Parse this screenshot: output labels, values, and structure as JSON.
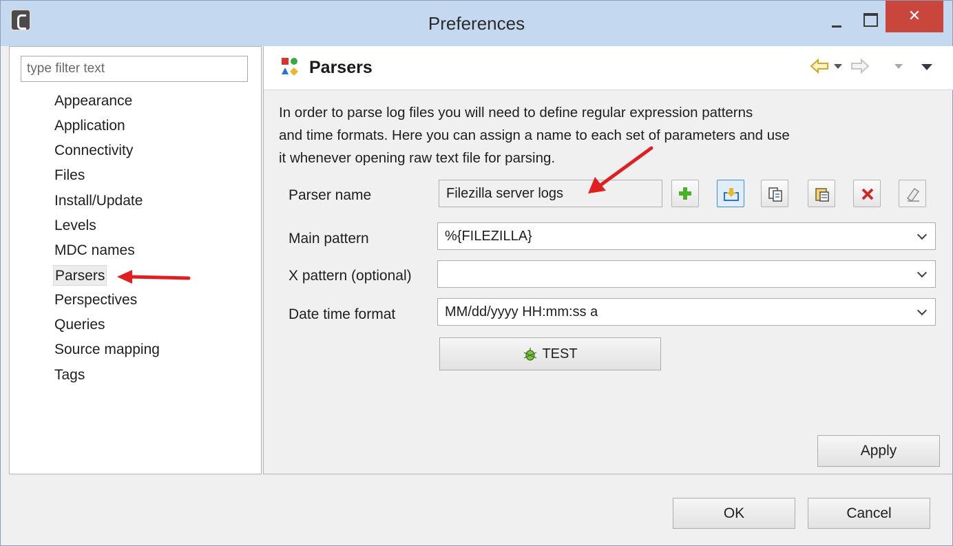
{
  "window": {
    "title": "Preferences",
    "close_glyph": "✕"
  },
  "sidebar": {
    "filter_placeholder": "type filter text",
    "items": [
      {
        "label": "Appearance"
      },
      {
        "label": "Application"
      },
      {
        "label": "Connectivity"
      },
      {
        "label": "Files"
      },
      {
        "label": "Install/Update"
      },
      {
        "label": "Levels"
      },
      {
        "label": "MDC names"
      },
      {
        "label": "Parsers",
        "selected": true
      },
      {
        "label": "Perspectives"
      },
      {
        "label": "Queries"
      },
      {
        "label": "Source mapping"
      },
      {
        "label": "Tags"
      }
    ]
  },
  "page": {
    "title": "Parsers",
    "description_lines": [
      "In order to parse log files you will need to define regular expression patterns",
      "and time formats. Here you can assign a name to each set of parameters and use",
      "it whenever opening raw text file for parsing."
    ],
    "fields": {
      "parser_name": {
        "label": "Parser name",
        "value": "Filezilla server logs"
      },
      "main_pattern": {
        "label": "Main pattern",
        "value": "%{FILEZILLA}"
      },
      "x_pattern": {
        "label": "X pattern (optional)",
        "value": ""
      },
      "date_time_format": {
        "label": "Date time format",
        "value": "MM/dd/yyyy HH:mm:ss a"
      }
    },
    "test_label": "TEST",
    "apply_label": "Apply"
  },
  "footer": {
    "ok_label": "OK",
    "cancel_label": "Cancel"
  },
  "colors": {
    "titlebar": "#c4d9f0",
    "close_button": "#c9463d",
    "annotation_arrow": "#e02020",
    "add_icon": "#4caf2a",
    "delete_icon": "#cc2a2a",
    "back_arrow": "#e8b82e"
  },
  "icons": [
    "app-icon",
    "parsers-icon",
    "back-arrow-icon",
    "forward-arrow-icon",
    "view-menu-icon",
    "add-icon",
    "import-icon",
    "copy-icon",
    "paste-icon",
    "delete-icon",
    "clear-icon",
    "bug-icon"
  ]
}
